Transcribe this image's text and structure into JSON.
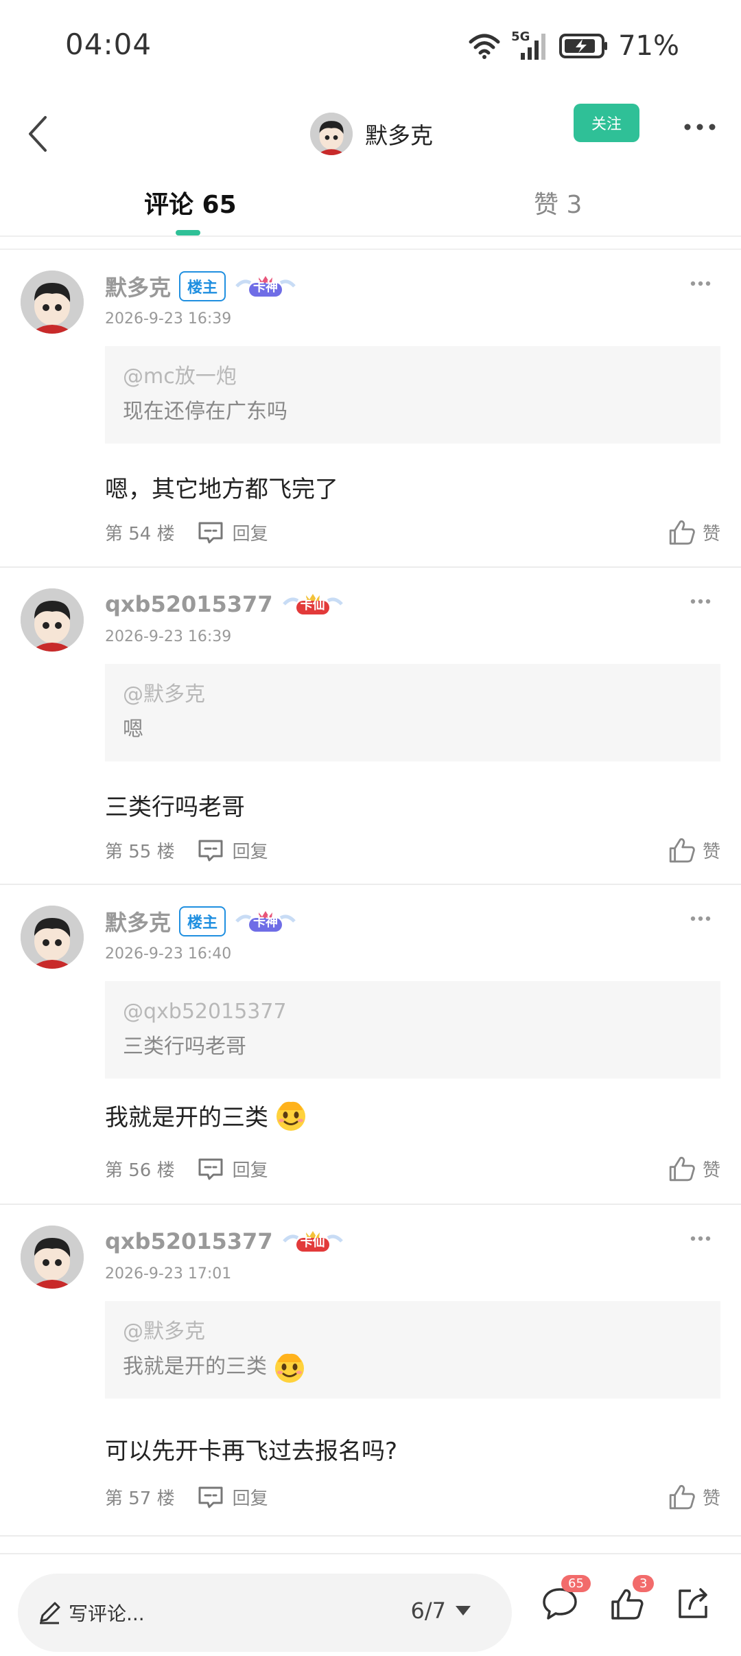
{
  "status": {
    "time": "04:04",
    "network": "5G",
    "battery": "71%"
  },
  "header": {
    "author": "默多克",
    "follow_label": "关注"
  },
  "tabs": {
    "comments": "评论 65",
    "likes": "赞 3"
  },
  "comments": [
    {
      "name": "默多克",
      "owner_badge": "楼主",
      "level_badge": "卡神",
      "time": "2026-9-23 16:39",
      "quote_at": "@mc放一炮",
      "quote_text": "现在还停在广东吗",
      "body": "嗯，其它地方都飞完了",
      "floor": "第 54 楼",
      "reply": "回复",
      "like": "赞"
    },
    {
      "name": "qxb52015377",
      "owner_badge": "",
      "level_badge": "卡仙",
      "time": "2026-9-23 16:39",
      "quote_at": "@默多克",
      "quote_text": "嗯",
      "body": "三类行吗老哥",
      "floor": "第 55 楼",
      "reply": "回复",
      "like": "赞"
    },
    {
      "name": "默多克",
      "owner_badge": "楼主",
      "level_badge": "卡神",
      "time": "2026-9-23 16:40",
      "quote_at": "@qxb52015377",
      "quote_text": "三类行吗老哥",
      "body": "我就是开的三类",
      "floor": "第 56 楼",
      "reply": "回复",
      "like": "赞"
    },
    {
      "name": "qxb52015377",
      "owner_badge": "",
      "level_badge": "卡仙",
      "time": "2026-9-23 17:01",
      "quote_at": "@默多克",
      "quote_text": "我就是开的三类",
      "body": "可以先开卡再飞过去报名吗?",
      "floor": "第 57 楼",
      "reply": "回复",
      "like": "赞"
    }
  ],
  "bottom": {
    "placeholder": "写评论...",
    "page": "6/7",
    "comment_count": "65",
    "like_count": "3"
  },
  "colors": {
    "accent": "#2fc097",
    "owner_blue": "#1f8fe0",
    "badge_red": "#f26b6b"
  }
}
